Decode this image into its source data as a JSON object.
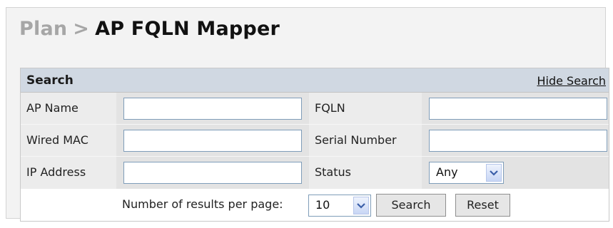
{
  "breadcrumb": {
    "parent": "Plan",
    "separator": ">",
    "current": "AP FQLN Mapper"
  },
  "search_panel": {
    "title": "Search",
    "hide_link": "Hide Search",
    "fields": {
      "ap_name": {
        "label": "AP Name",
        "value": ""
      },
      "fqln": {
        "label": "FQLN",
        "value": ""
      },
      "wired_mac": {
        "label": "Wired MAC",
        "value": ""
      },
      "serial_number": {
        "label": "Serial Number",
        "value": ""
      },
      "ip_address": {
        "label": "IP Address",
        "value": ""
      },
      "status": {
        "label": "Status",
        "selected": "Any"
      }
    },
    "results_per_page": {
      "label": "Number of results per page:",
      "selected": "10"
    },
    "buttons": {
      "search": "Search",
      "reset": "Reset"
    }
  },
  "colors": {
    "header_bg": "#d0d8e2",
    "input_border": "#7f9db9"
  }
}
